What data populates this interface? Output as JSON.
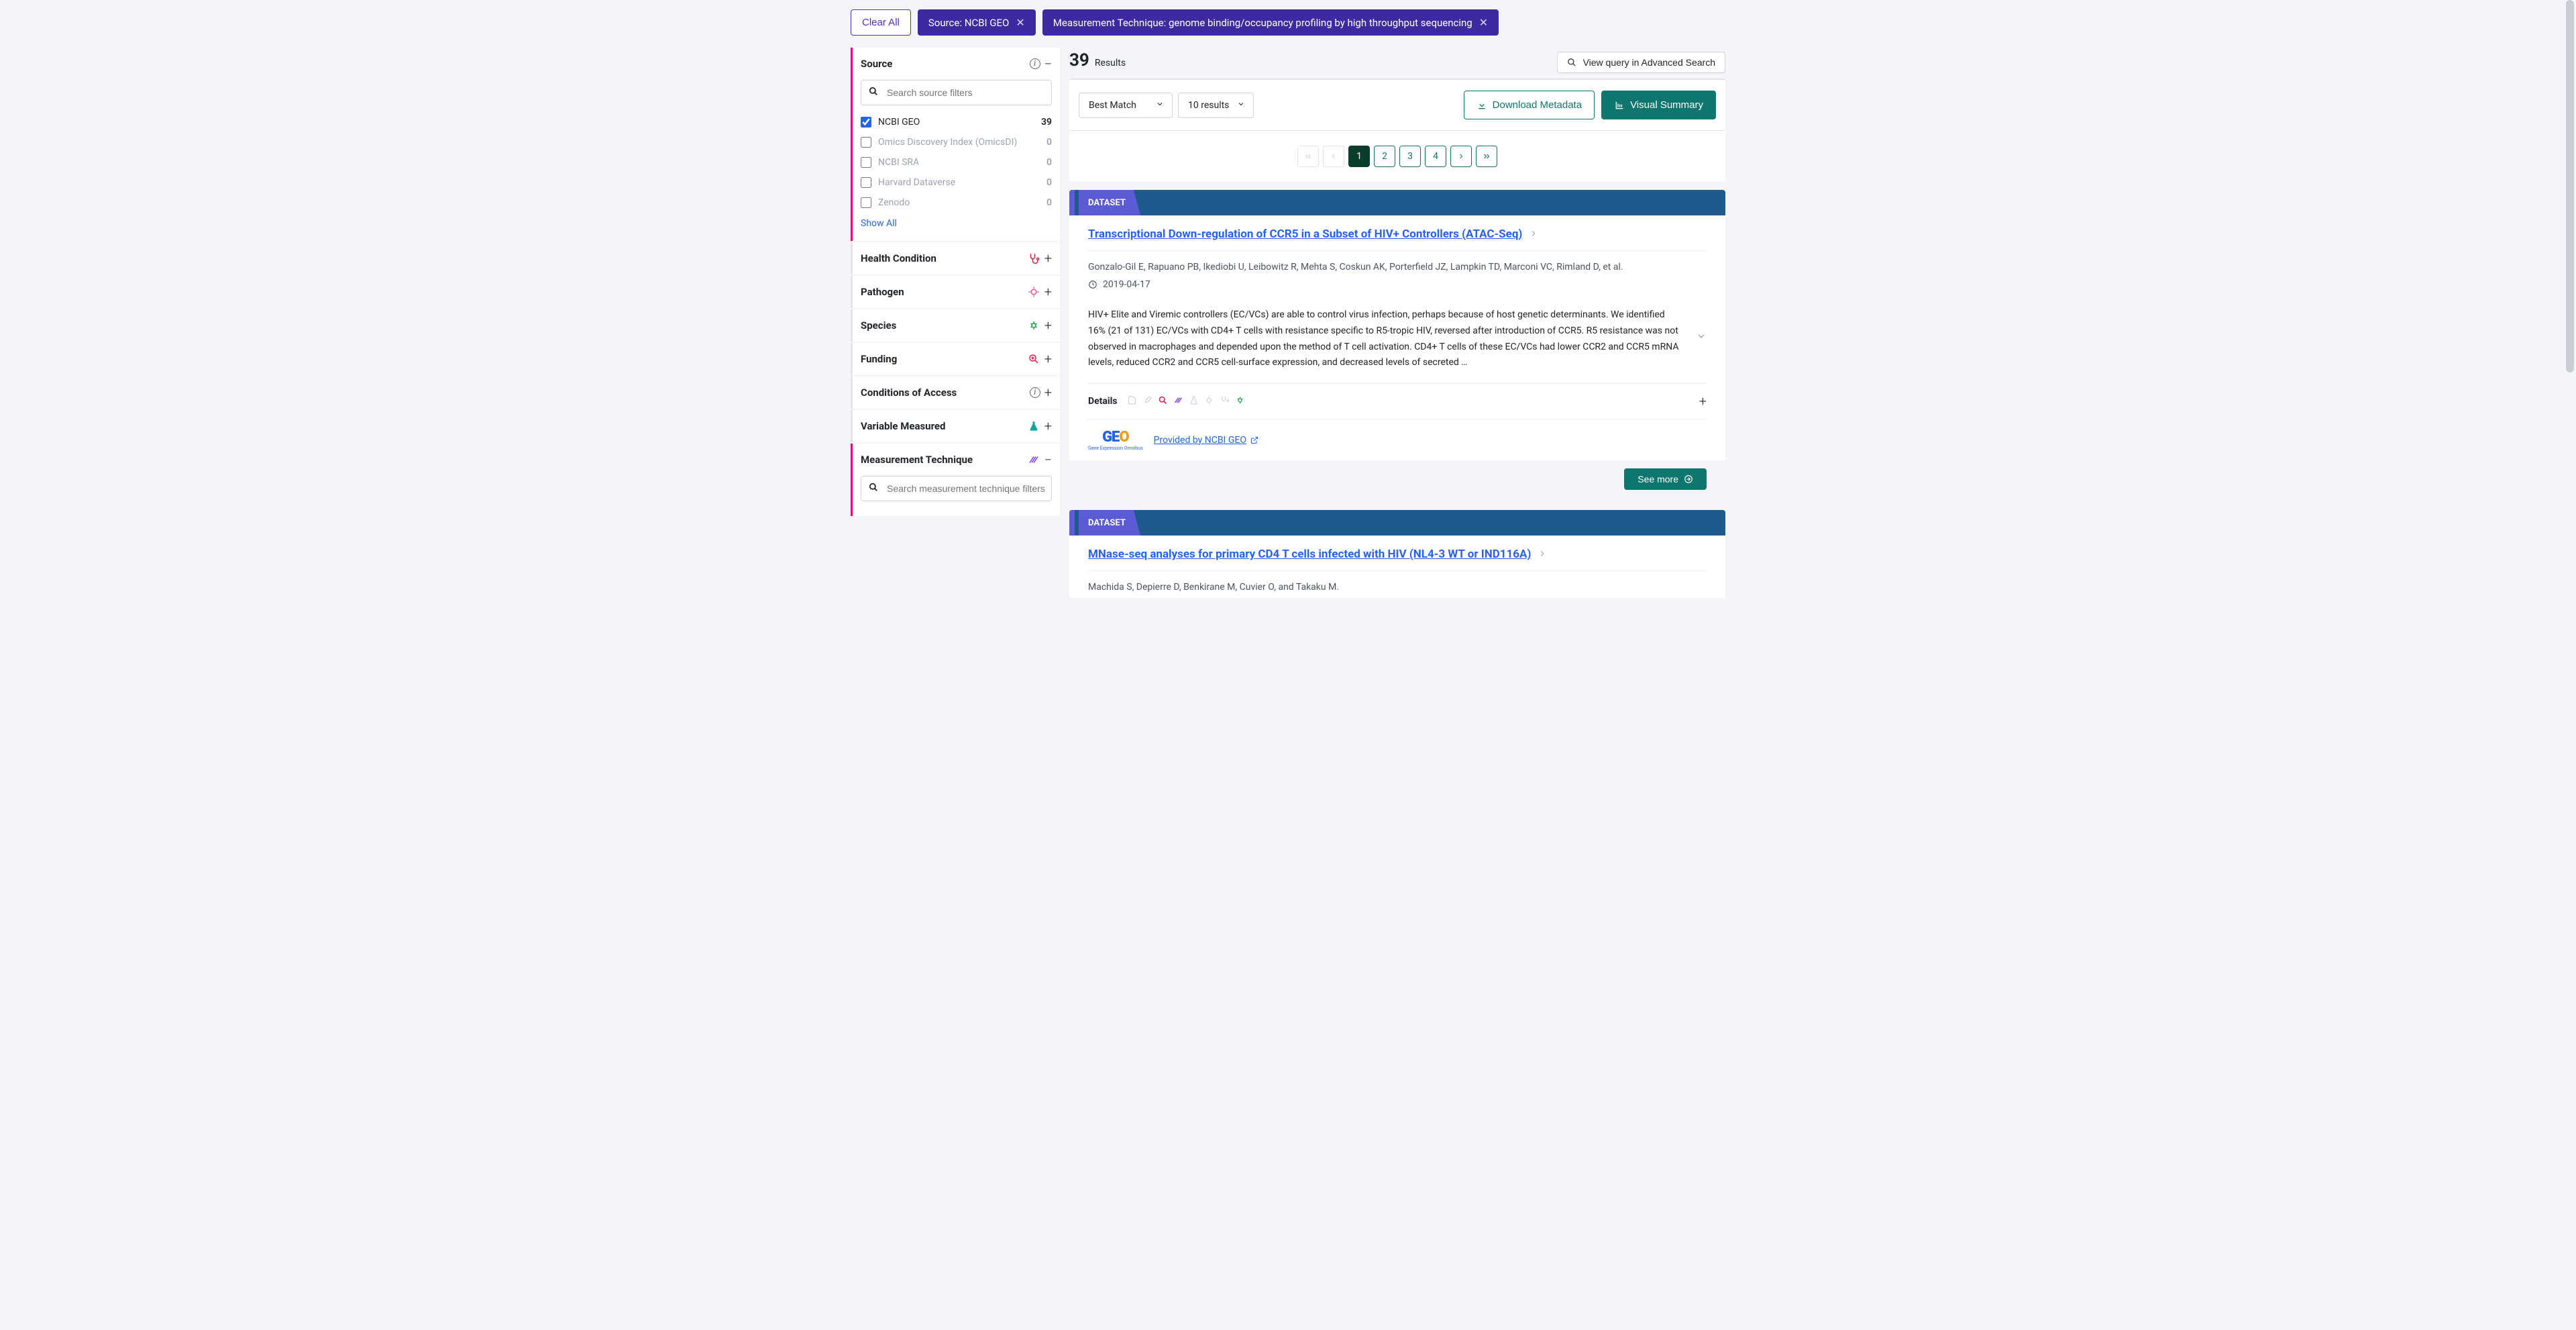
{
  "chips": {
    "clear": "Clear All",
    "source": "Source: NCBI GEO",
    "technique": "Measurement Technique: genome binding/occupancy profiling by high throughput sequencing"
  },
  "facets": {
    "source": {
      "title": "Source",
      "placeholder": "Search source filters",
      "items": [
        {
          "label": "NCBI GEO",
          "count": "39",
          "checked": true
        },
        {
          "label": "Omics Discovery Index (OmicsDI)",
          "count": "0",
          "checked": false
        },
        {
          "label": "NCBI SRA",
          "count": "0",
          "checked": false
        },
        {
          "label": "Harvard Dataverse",
          "count": "0",
          "checked": false
        },
        {
          "label": "Zenodo",
          "count": "0",
          "checked": false
        }
      ],
      "show_all": "Show All"
    },
    "health": {
      "title": "Health Condition"
    },
    "pathogen": {
      "title": "Pathogen"
    },
    "species": {
      "title": "Species"
    },
    "funding": {
      "title": "Funding"
    },
    "access": {
      "title": "Conditions of Access"
    },
    "variable": {
      "title": "Variable Measured"
    },
    "technique": {
      "title": "Measurement Technique",
      "placeholder": "Search measurement technique filters"
    }
  },
  "results": {
    "count": "39",
    "label": "Results",
    "adv": "View query in Advanced Search",
    "sort": "Best Match",
    "per": "10 results",
    "download": "Download Metadata",
    "visual": "Visual Summary"
  },
  "pagination": {
    "pages": [
      "1",
      "2",
      "3",
      "4"
    ],
    "active": "1"
  },
  "cards": [
    {
      "band": "DATASET",
      "title": "Transcriptional Down-regulation of CCR5 in a Subset of HIV+ Controllers (ATAC-Seq)",
      "authors": "Gonzalo-Gil E, Rapuano PB, Ikediobi U, Leibowitz R, Mehta S, Coskun AK, Porterfield JZ, Lampkin TD, Marconi VC, Rimland D, et al.",
      "date": "2019-04-17",
      "desc": "HIV+ Elite and Viremic controllers (EC/VCs) are able to control virus infection, perhaps because of host genetic determinants. We identified 16% (21 of 131) EC/VCs with CD4+ T cells with resistance specific to R5-tropic HIV, reversed after introduction of CCR5. R5 resistance was not observed in macrophages and depended upon the method of T cell activation. CD4+ T cells of these EC/VCs had lower CCR2 and CCR5 mRNA levels, reduced CCR2 and CCR5 cell-surface expression, and decreased levels of secreted …",
      "details": "Details",
      "provider": "Provided by NCBI GEO",
      "seemore": "See more"
    },
    {
      "band": "DATASET",
      "title": "MNase-seq analyses for primary CD4 T cells infected with HIV (NL4-3 WT or IND116A)",
      "authors": "Machida S, Depierre D, Benkirane M, Cuvier O, and Takaku M."
    }
  ],
  "icon_colors": {
    "health": "#e11d48",
    "pathogen": "#e879a5",
    "species": "#16a34a",
    "funding": "#e11d48",
    "variable": "#0ea5a0",
    "technique": "#7c3aed"
  }
}
